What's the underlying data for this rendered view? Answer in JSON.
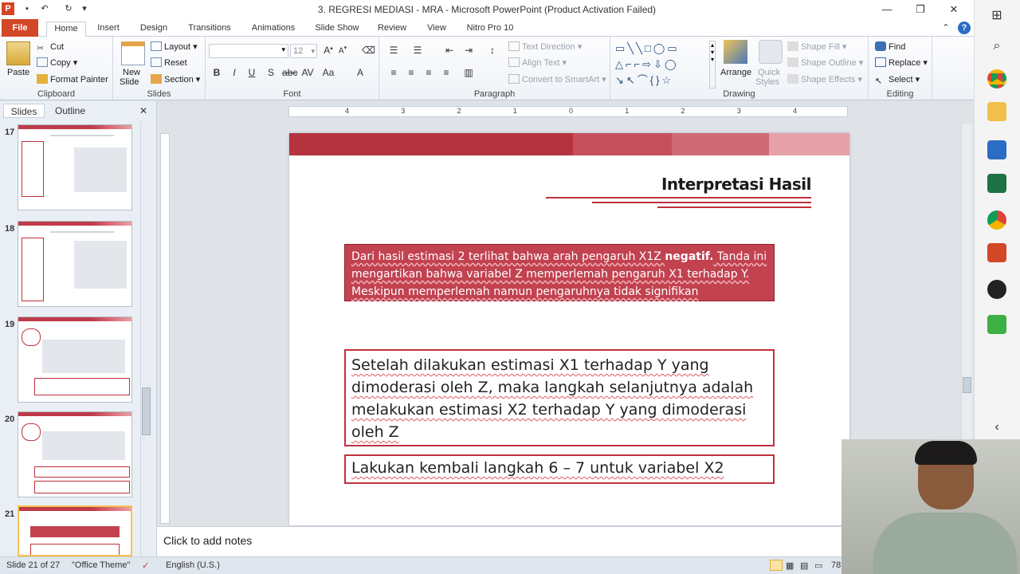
{
  "window": {
    "title": "3. REGRESI MEDIASI - MRA  -  Microsoft PowerPoint (Product Activation Failed)"
  },
  "tabs": [
    "File",
    "Home",
    "Insert",
    "Design",
    "Transitions",
    "Animations",
    "Slide Show",
    "Review",
    "View",
    "Nitro Pro 10"
  ],
  "ribbon": {
    "clipboard": {
      "label": "Clipboard",
      "paste": "Paste",
      "cut": "Cut",
      "copy": "Copy",
      "format_painter": "Format Painter"
    },
    "slides": {
      "label": "Slides",
      "new_slide": "New",
      "new_slide2": "Slide",
      "layout": "Layout",
      "reset": "Reset",
      "section": "Section"
    },
    "font": {
      "label": "Font",
      "size": "12"
    },
    "paragraph": {
      "label": "Paragraph",
      "text_direction": "Text Direction",
      "align_text": "Align Text",
      "convert": "Convert to SmartArt"
    },
    "drawing": {
      "label": "Drawing",
      "arrange": "Arrange",
      "quick_styles": "Quick",
      "quick_styles2": "Styles",
      "shape_fill": "Shape Fill",
      "shape_outline": "Shape Outline",
      "shape_effects": "Shape Effects"
    },
    "editing": {
      "label": "Editing",
      "find": "Find",
      "replace": "Replace",
      "select": "Select"
    }
  },
  "leftpane": {
    "tab_slides": "Slides",
    "tab_outline": "Outline",
    "thumbs": [
      "17",
      "18",
      "19",
      "20",
      "21"
    ]
  },
  "slide": {
    "title": "Interpretasi Hasil",
    "box1_pre": "Dari hasil estimasi 2 terlihat bahwa arah pengaruh X1Z ",
    "box1_bold": "negatif.",
    "box1_post": " Tanda ini mengartikan bahwa variabel Z memperlemah pengaruh X1 terhadap Y. Meskipun memperlemah namun pengaruhnya tidak signifikan",
    "box2": "Setelah dilakukan estimasi X1 terhadap Y yang dimoderasi oleh Z, maka langkah selanjutnya adalah melakukan estimasi X2 terhadap Y yang dimoderasi oleh Z",
    "box3": "Lakukan kembali langkah 6 – 7 untuk variabel X2"
  },
  "notes": {
    "placeholder": "Click to add notes"
  },
  "status": {
    "slide": "Slide 21 of 27",
    "theme": "\"Office Theme\"",
    "language": "English (U.S.)",
    "zoom": "78"
  },
  "ruler": {
    "ticks": [
      "4",
      "3",
      "2",
      "1",
      "0",
      "1",
      "2",
      "3",
      "4"
    ]
  },
  "colors": {
    "accent": "#c0303d",
    "file_tab": "#d24726"
  }
}
